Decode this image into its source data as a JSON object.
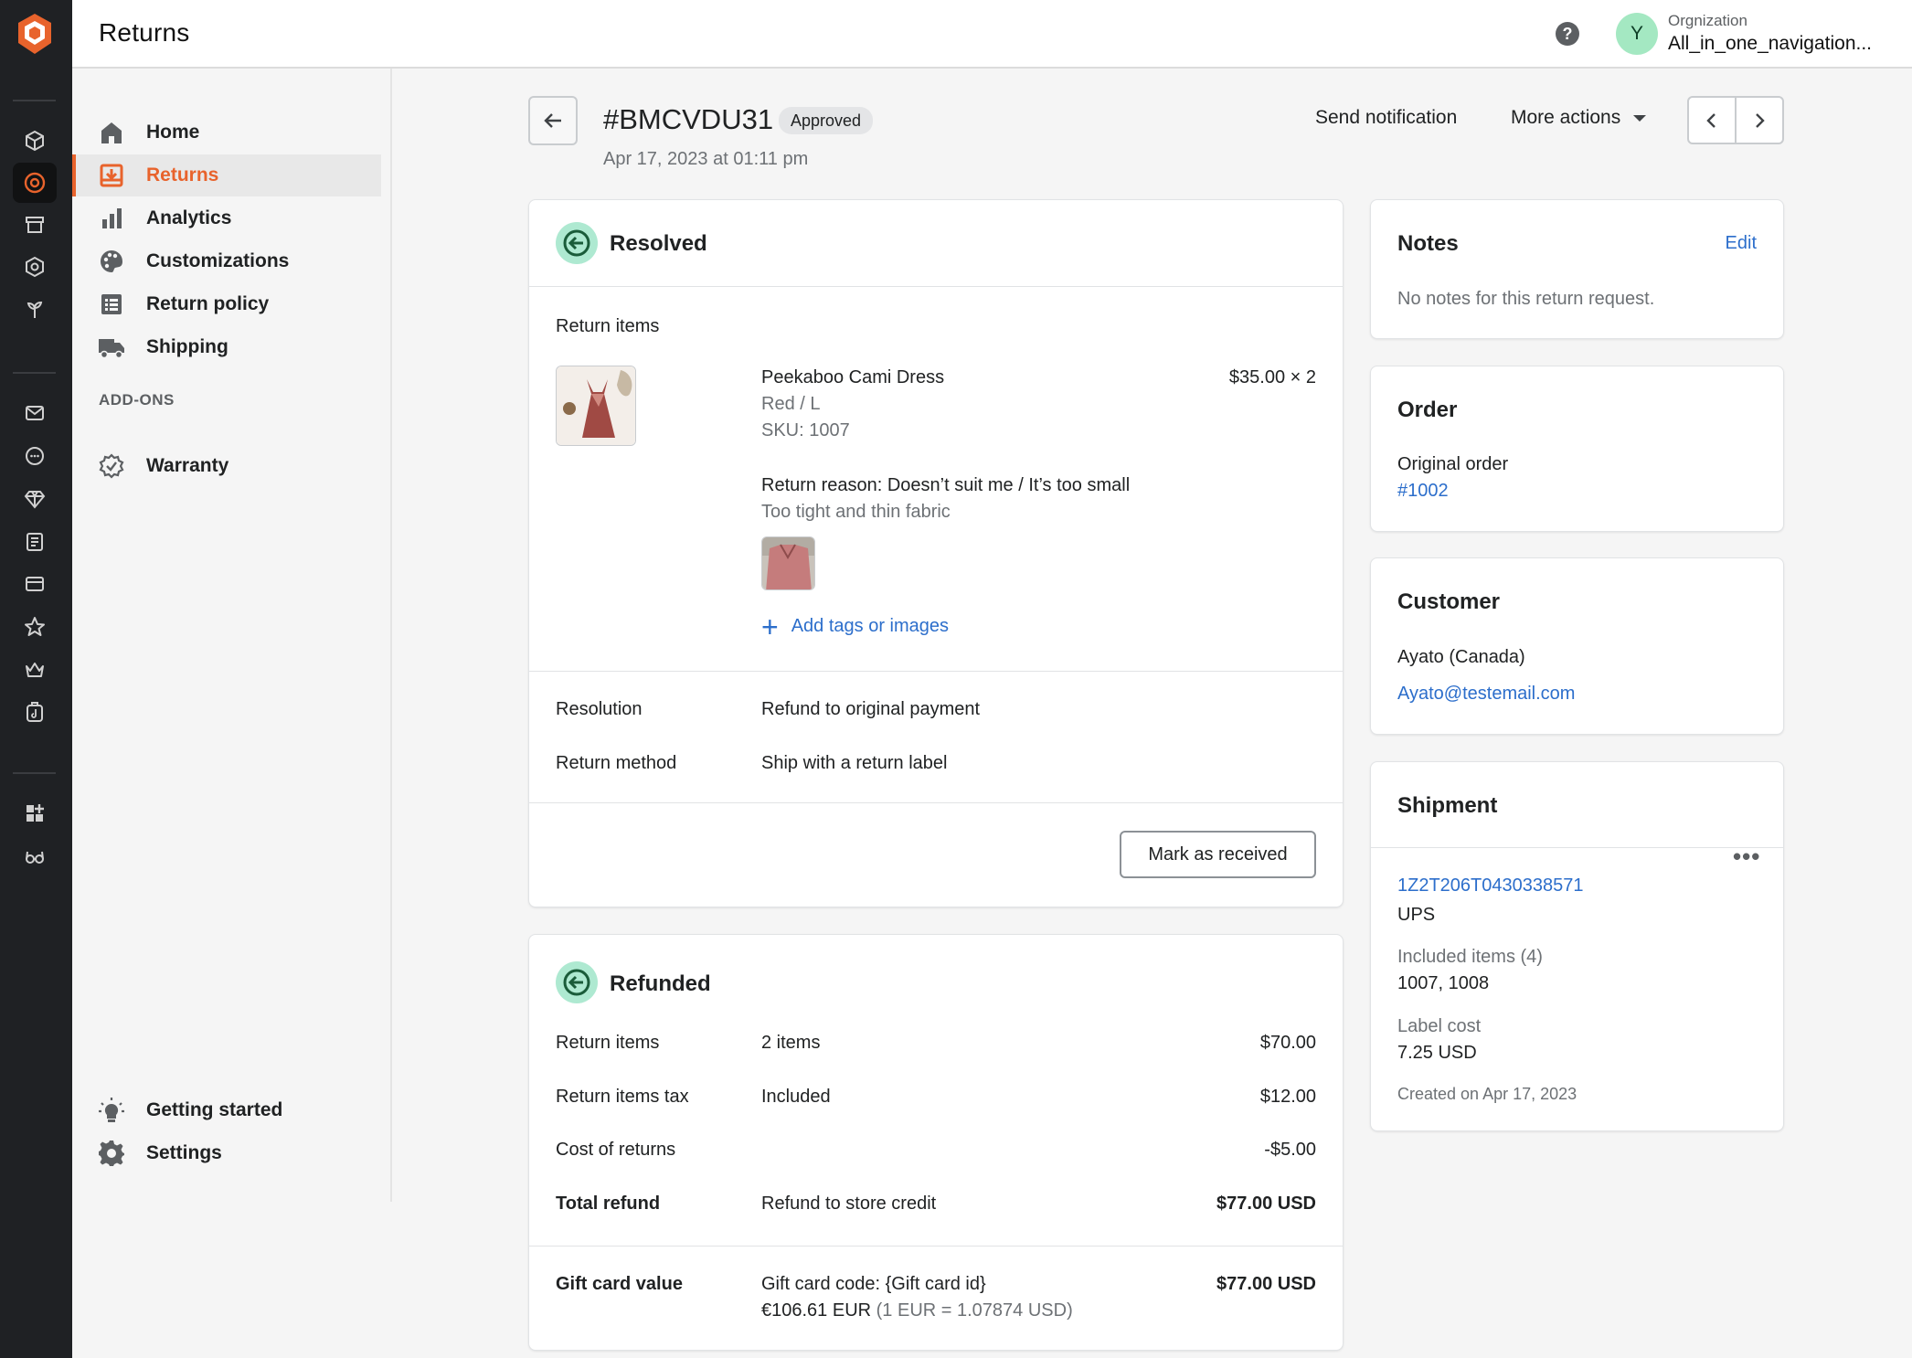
{
  "topbar": {
    "title": "Returns",
    "org_label": "Orgnization",
    "org_name": "All_in_one_navigation...",
    "avatar_initial": "Y"
  },
  "sidenav": {
    "items": [
      {
        "label": "Home",
        "icon": "home-icon"
      },
      {
        "label": "Returns",
        "icon": "returns-icon",
        "active": true
      },
      {
        "label": "Analytics",
        "icon": "analytics-icon"
      },
      {
        "label": "Customizations",
        "icon": "palette-icon"
      },
      {
        "label": "Return policy",
        "icon": "list-icon"
      },
      {
        "label": "Shipping",
        "icon": "truck-icon"
      }
    ],
    "addons_label": "ADD-ONS",
    "addons": [
      {
        "label": "Warranty",
        "icon": "badge-check-icon"
      }
    ],
    "bottom": [
      {
        "label": "Getting started",
        "icon": "lightbulb-icon"
      },
      {
        "label": "Settings",
        "icon": "gear-icon"
      }
    ]
  },
  "header": {
    "return_id": "#BMCVDU31",
    "status": "Approved",
    "date": "Apr 17, 2023 at 01:11 pm",
    "send_notification": "Send notification",
    "more_actions": "More actions"
  },
  "resolved": {
    "title": "Resolved",
    "return_items_label": "Return items",
    "item": {
      "name": "Peekaboo Cami Dress",
      "variant": "Red / L",
      "sku": "SKU: 1007",
      "price": "$35.00 × 2",
      "reason": "Return reason: Doesn’t suit me / It’s too small",
      "note": "Too tight and thin fabric"
    },
    "add_tags": "Add tags or images",
    "resolution_label": "Resolution",
    "resolution_value": "Refund to original payment",
    "method_label": "Return method",
    "method_value": "Ship with a return label",
    "mark_received": "Mark as received"
  },
  "refunded": {
    "title": "Refunded",
    "rows": [
      {
        "label": "Return items",
        "mid": "2 items",
        "amount": "$70.00"
      },
      {
        "label": "Return items tax",
        "mid": "Included",
        "amount": "$12.00"
      },
      {
        "label": "Cost of returns",
        "mid": "",
        "amount": "-$5.00"
      },
      {
        "label": "Total refund",
        "mid": "Refund to store credit",
        "amount": "$77.00 USD"
      }
    ],
    "gift_label": "Gift card value",
    "gift_code": "Gift card code: {Gift card id}",
    "gift_eur": "€106.61 EUR",
    "gift_rate": "(1 EUR = 1.07874 USD)",
    "gift_amount": "$77.00 USD"
  },
  "notes": {
    "title": "Notes",
    "edit": "Edit",
    "text": "No notes for this return request."
  },
  "order": {
    "title": "Order",
    "label": "Original order",
    "link": "#1002"
  },
  "customer": {
    "title": "Customer",
    "name": "Ayato (Canada)",
    "email": "Ayato@testemail.com"
  },
  "shipment": {
    "title": "Shipment",
    "tracking": "1Z2T206T0430338571",
    "carrier": "UPS",
    "included_label": "Included items (4)",
    "included_value": "1007, 1008",
    "cost_label": "Label cost",
    "cost_value": "7.25 USD",
    "created": "Created on Apr 17, 2023"
  },
  "colors": {
    "accent": "#e8632c",
    "link": "#2c6ecb",
    "rail": "#1f2124",
    "success_bg": "#aee9d1"
  }
}
